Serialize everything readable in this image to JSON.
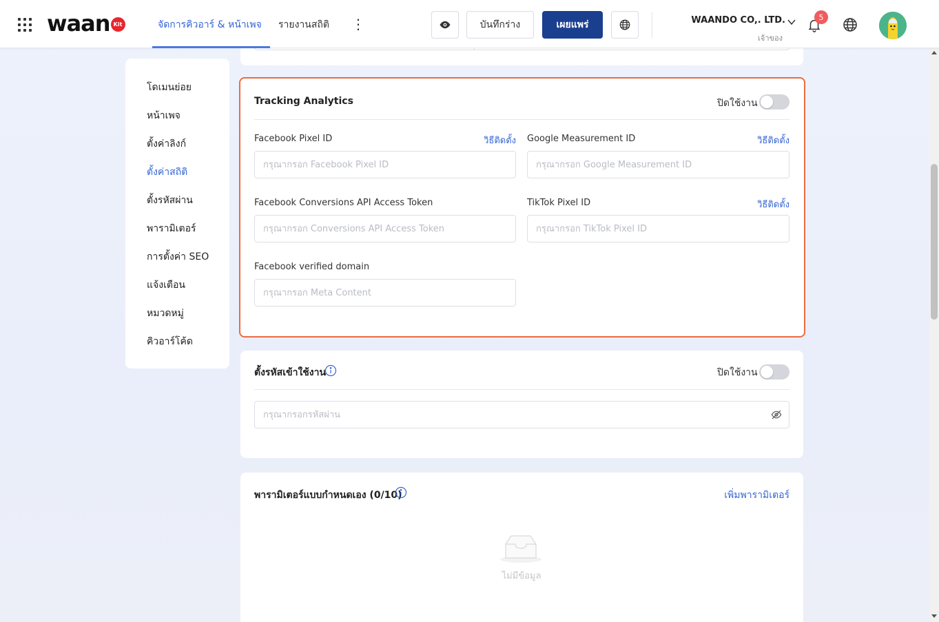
{
  "header": {
    "logo_text": "waan",
    "logo_badge": "Kit",
    "tabs": [
      {
        "label": "จัดการคิวอาร์ & หน้าเพจ"
      },
      {
        "label": "รายงานสถิติ"
      }
    ],
    "more_icon": "⋮",
    "draft_label": "บันทึกร่าง",
    "publish_label": "เผยแพร่",
    "company_name": "WAANDO CO,. LTD.",
    "role_label": "เจ้าของ",
    "notification_count": "5"
  },
  "sidebar": {
    "items": [
      {
        "label": "โดเมนย่อย"
      },
      {
        "label": "หน้าเพจ"
      },
      {
        "label": "ตั้งค่าลิงก์"
      },
      {
        "label": "ตั้งค่าสถิติ"
      },
      {
        "label": "ตั้งรหัสผ่าน"
      },
      {
        "label": "พารามิเตอร์"
      },
      {
        "label": "การตั้งค่า SEO"
      },
      {
        "label": "แจ้งเตือน"
      },
      {
        "label": "หมวดหมู่"
      },
      {
        "label": "คิวอาร์โค้ด"
      }
    ],
    "active_index": 3
  },
  "tracking": {
    "title": "Tracking Analytics",
    "toggle_label": "ปิดใช้งาน",
    "fields": {
      "fb_pixel": {
        "label": "Facebook Pixel ID",
        "link": "วิธีติดตั้ง",
        "placeholder": "กรุณากรอก Facebook Pixel ID",
        "value": ""
      },
      "google": {
        "label": "Google Measurement ID",
        "link": "วิธีติดตั้ง",
        "placeholder": "กรุณากรอก Google Measurement ID",
        "value": ""
      },
      "fb_capi": {
        "label": "Facebook Conversions API Access Token",
        "placeholder": "กรุณากรอก Conversions API Access Token",
        "value": ""
      },
      "tiktok": {
        "label": "TikTok Pixel ID",
        "link": "วิธีติดตั้ง",
        "placeholder": "กรุณากรอก TikTok Pixel ID",
        "value": ""
      },
      "fb_domain": {
        "label": "Facebook verified domain",
        "placeholder": "กรุณากรอก Meta Content",
        "value": ""
      }
    }
  },
  "password": {
    "title": "ตั้งรหัสเข้าใช้งาน",
    "toggle_label": "ปิดใช้งาน",
    "placeholder": "กรุณากรอกรหัสผ่าน",
    "value": ""
  },
  "params": {
    "title": "พารามิเตอร์แบบกำหนดเอง (0/10)",
    "add_link": "เพิ่มพารามิเตอร์",
    "empty_text": "ไม่มีข้อมูล"
  },
  "colors": {
    "accent": "#3565d6",
    "publish_bg": "#1b3f8f",
    "highlight_border": "#ec6a3f",
    "badge_red": "#f25c5c"
  }
}
